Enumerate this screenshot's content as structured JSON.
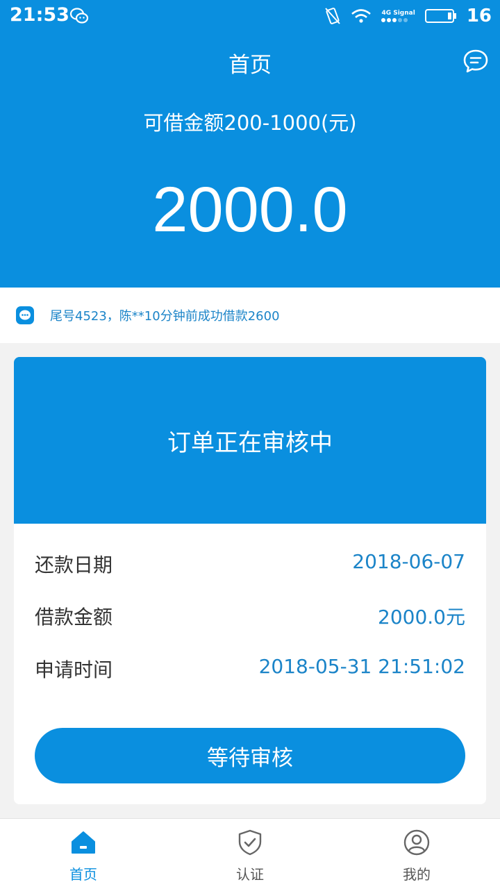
{
  "status_bar": {
    "time": "21:53",
    "network_label": "4G Signal",
    "battery_percent": "16",
    "icons": [
      "wechat-icon",
      "vibrate-icon",
      "wifi-icon",
      "signal-icon",
      "battery-icon"
    ]
  },
  "header": {
    "title": "首页",
    "subtitle": "可借金额200-1000(元)",
    "amount": "2000.0",
    "message_icon": "message-icon"
  },
  "notice": {
    "text": "尾号4523，陈**10分钟前成功借款2600",
    "icon": "chat-bubble-icon"
  },
  "order_card": {
    "status_title": "订单正在审核中",
    "rows": [
      {
        "label": "还款日期",
        "value": "2018-06-07"
      },
      {
        "label": "借款金额",
        "value": "2000.0元"
      },
      {
        "label": "申请时间",
        "value": "2018-05-31 21:51:02"
      }
    ],
    "button_label": "等待审核"
  },
  "tabs": [
    {
      "label": "首页",
      "icon": "home-icon",
      "active": true
    },
    {
      "label": "认证",
      "icon": "shield-check-icon",
      "active": false
    },
    {
      "label": "我的",
      "icon": "user-icon",
      "active": false
    }
  ],
  "colors": {
    "primary": "#0a8fdf",
    "value_text": "#1b84c8",
    "background": "#f2f2f2"
  }
}
